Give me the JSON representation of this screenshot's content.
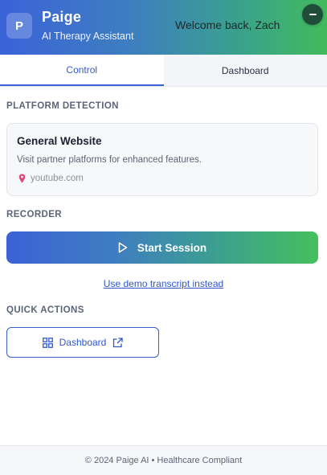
{
  "header": {
    "logo_letter": "P",
    "title": "Paige",
    "subtitle": "AI Therapy Assistant",
    "welcome": "Welcome back, Zach",
    "minimize_icon": "minus-icon"
  },
  "tabs": [
    {
      "label": "Control",
      "active": true
    },
    {
      "label": "Dashboard",
      "active": false
    }
  ],
  "platform": {
    "heading": "PLATFORM DETECTION",
    "title": "General Website",
    "description": "Visit partner platforms for enhanced features.",
    "site": "youtube.com",
    "site_icon": "map-pin-icon"
  },
  "recorder": {
    "heading": "RECORDER",
    "start_label": "Start Session",
    "start_icon": "play-icon",
    "demo_link": "Use demo transcript instead"
  },
  "quick_actions": {
    "heading": "QUICK ACTIONS",
    "dashboard_label": "Dashboard",
    "dashboard_icon": "grid-icon",
    "external_icon": "external-link-icon"
  },
  "footer": {
    "text": "© 2024 Paige AI • Healthcare Compliant"
  },
  "colors": {
    "brand_blue": "#3b63d8",
    "brand_green": "#41bb5c",
    "link_blue": "#2f57c9"
  }
}
